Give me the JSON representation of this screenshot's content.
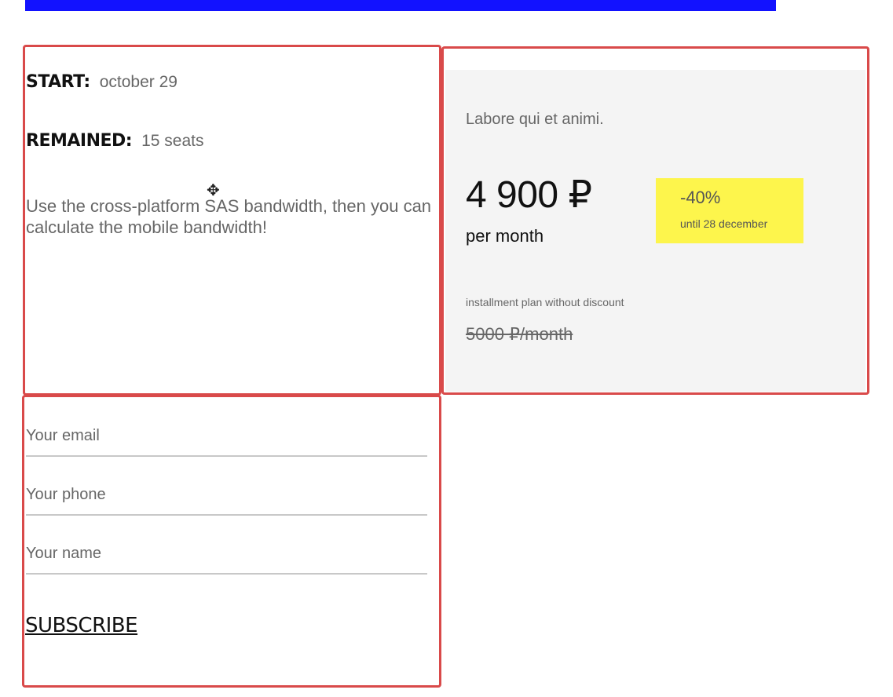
{
  "course": {
    "start_label": "START:",
    "start_value": "october 29",
    "remained_label": "REMAINED:",
    "remained_value": "15 seats",
    "description": "Use the cross-platform SAS bandwidth, then you can calculate the mobile bandwidth!"
  },
  "pricing": {
    "tagline": "Labore qui et animi.",
    "price": "4 900 ₽",
    "period": "per month",
    "discount_percent": "-40%",
    "discount_until": "until 28 december",
    "installment_note": "installment plan without discount",
    "old_price": "5000 ₽/month"
  },
  "form": {
    "email_placeholder": "Your email",
    "phone_placeholder": "Your phone",
    "name_placeholder": "Your name",
    "subscribe_label": "SUBSCRIBE"
  },
  "colors": {
    "top_bar": "#1212ff",
    "frame_outline": "#d94a4a",
    "price_card_bg": "#f4f4f4",
    "discount_badge_bg": "#fdf54c"
  },
  "icons": {
    "cursor": "move-cursor-icon"
  }
}
